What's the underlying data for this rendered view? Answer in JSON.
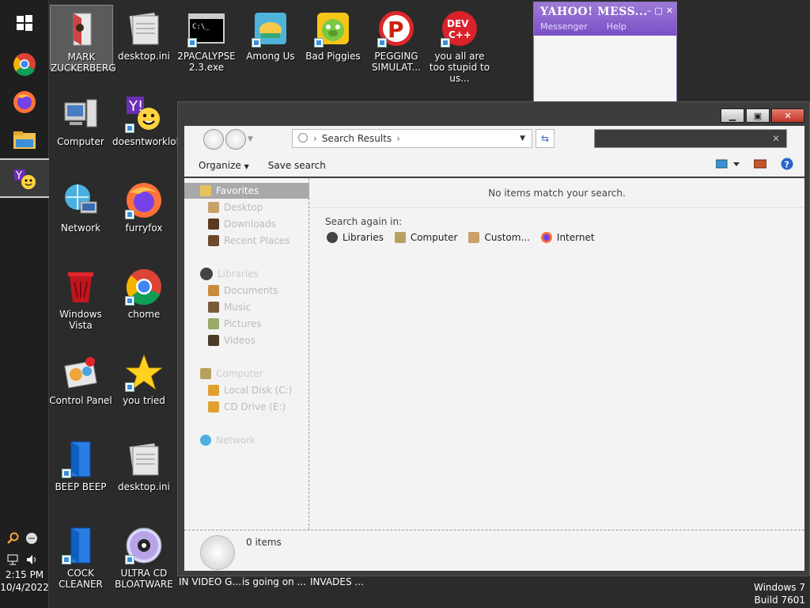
{
  "taskbar": {
    "apps": [
      {
        "name": "start",
        "icon": "windows-logo-icon"
      },
      {
        "name": "chrome",
        "icon": "chrome-icon"
      },
      {
        "name": "firefox",
        "icon": "firefox-icon"
      },
      {
        "name": "explorer",
        "icon": "folder-icon"
      },
      {
        "name": "yahoo",
        "icon": "yahoo-messenger-icon"
      }
    ],
    "clock": {
      "time": "2:15 PM",
      "date": "10/4/2022"
    }
  },
  "desktop_icons": [
    {
      "label": "MARK ZUCKERBERG",
      "icon": "user-icon",
      "selected": true
    },
    {
      "label": "desktop.ini",
      "icon": "document-icon"
    },
    {
      "label": "2PACALYPSE 2.3.exe",
      "icon": "cmd-icon"
    },
    {
      "label": "Among Us",
      "icon": "game-icon"
    },
    {
      "label": "Bad Piggies",
      "icon": "pig-icon"
    },
    {
      "label": "PEGGING SIMULAT...",
      "icon": "game-icon"
    },
    {
      "label": "you all are too stupid to us...",
      "icon": "devcpp-icon"
    },
    {
      "label": "Computer",
      "icon": "computer-icon"
    },
    {
      "label": "doesntworklol",
      "icon": "yahoo-messenger-icon"
    },
    {
      "label": "Network",
      "icon": "network-icon"
    },
    {
      "label": "furryfox",
      "icon": "firefox-icon"
    },
    {
      "label": "Windows Vista",
      "icon": "recycle-bin-icon"
    },
    {
      "label": "chome",
      "icon": "chrome-icon"
    },
    {
      "label": "Control Panel",
      "icon": "control-panel-icon"
    },
    {
      "label": "you tried",
      "icon": "star-icon"
    },
    {
      "label": "BEEP BEEP",
      "icon": "blue-file-icon"
    },
    {
      "label": "desktop.ini",
      "icon": "document-icon"
    },
    {
      "label": "COCK CLEANER",
      "icon": "blue-file-icon"
    },
    {
      "label": "ULTRA CD BLOATWARE",
      "icon": "cd-icon"
    }
  ],
  "bottom_labels": [
    "IN VIDEO G...",
    "is going on ...",
    "INVADES ..."
  ],
  "yahoo": {
    "title": "YAHOO! MESS...",
    "menu": [
      "Messenger",
      "Help"
    ]
  },
  "explorer": {
    "address": "Search Results",
    "search_placeholder": "",
    "commands": {
      "organize": "Organize",
      "save_search": "Save search"
    },
    "nav": {
      "favorites": "Favorites",
      "favorites_items": [
        "Desktop",
        "Downloads",
        "Recent Places"
      ],
      "libraries": "Libraries",
      "libraries_items": [
        "Documents",
        "Music",
        "Pictures",
        "Videos"
      ],
      "computer": "Computer",
      "computer_items": [
        "Local Disk (C:)",
        "CD Drive (E:)"
      ],
      "network": "Network"
    },
    "no_items": "No items match your search.",
    "search_again": "Search again in:",
    "locations": [
      "Libraries",
      "Computer",
      "Custom...",
      "Internet"
    ],
    "item_count": "0 items"
  },
  "os": {
    "line1": "Windows 7",
    "line2": "Build 7601"
  }
}
